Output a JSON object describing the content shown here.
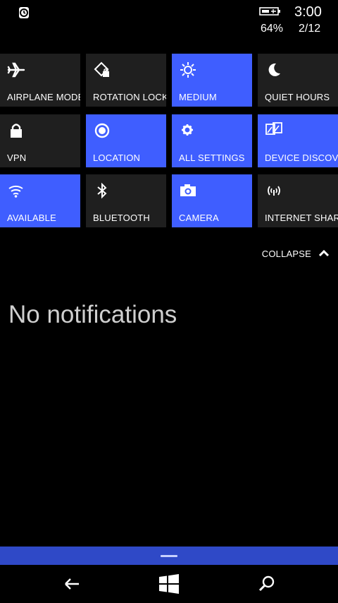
{
  "status": {
    "time": "3:00",
    "battery_percent": "64%",
    "date": "2/12",
    "left_icon": "sync-icon",
    "battery_icon": "battery-charging-icon"
  },
  "tiles": [
    {
      "label": "AIRPLANE MODE",
      "icon": "airplane-icon",
      "active": false
    },
    {
      "label": "ROTATION LOCK",
      "icon": "rotation-lock-icon",
      "active": false
    },
    {
      "label": "MEDIUM",
      "icon": "brightness-icon",
      "active": true
    },
    {
      "label": "QUIET HOURS",
      "icon": "moon-icon",
      "active": false
    },
    {
      "label": "VPN",
      "icon": "lock-icon",
      "active": false
    },
    {
      "label": "LOCATION",
      "icon": "location-icon",
      "active": true
    },
    {
      "label": "ALL SETTINGS",
      "icon": "gear-icon",
      "active": true
    },
    {
      "label": "DEVICE DISCOVERY",
      "icon": "device-discovery-icon",
      "active": true
    },
    {
      "label": "AVAILABLE",
      "icon": "wifi-icon",
      "active": true
    },
    {
      "label": "BLUETOOTH",
      "icon": "bluetooth-icon",
      "active": false
    },
    {
      "label": "CAMERA",
      "icon": "camera-icon",
      "active": true
    },
    {
      "label": "INTERNET SHARING",
      "icon": "internet-sharing-icon",
      "active": false
    }
  ],
  "collapse_label": "COLLAPSE",
  "empty_message": "No notifications",
  "nav": {
    "back_icon": "back-arrow-icon",
    "start_icon": "windows-logo-icon",
    "search_icon": "search-icon"
  },
  "colors": {
    "tile_active": "#3f5eff",
    "tile_inactive": "#1f1f1f",
    "handle_bar": "#2f49c7"
  }
}
